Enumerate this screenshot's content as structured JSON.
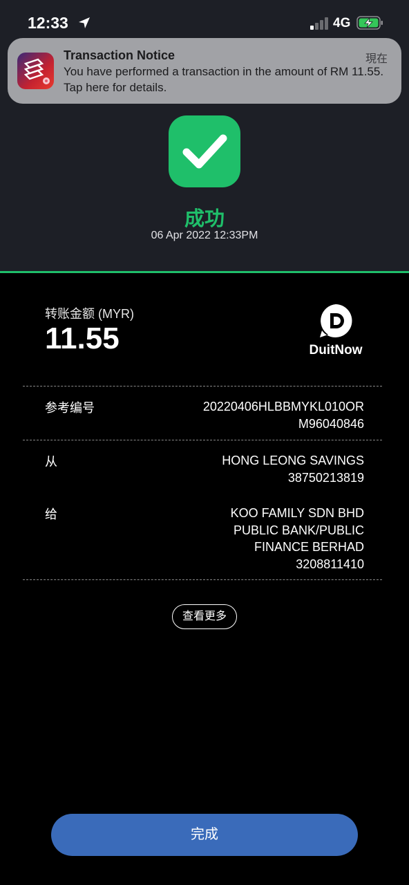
{
  "status_bar": {
    "time": "12:33",
    "network": "4G",
    "icons": [
      "location-arrow-icon",
      "signal-icon",
      "battery-charging-icon"
    ]
  },
  "notification": {
    "title": "Transaction Notice",
    "time": "現在",
    "body": "You have performed a transaction in the amount of RM 11.55. Tap here for details.",
    "app_icon": "bank-app-icon"
  },
  "result": {
    "icon": "checkmark-icon",
    "status": "成功",
    "datetime": "06 Apr 2022 12:33PM"
  },
  "transfer": {
    "amount_label": "转账金额 (MYR)",
    "amount": "11.55",
    "brand": "DuitNow"
  },
  "details": {
    "reference": {
      "label": "参考编号",
      "line1": "20220406HLBBMYKL010OR",
      "line2": "M96040846"
    },
    "from": {
      "label": "从",
      "line1": "HONG LEONG SAVINGS",
      "line2": "38750213819"
    },
    "to": {
      "label": "给",
      "line1": "KOO FAMILY SDN BHD",
      "line2": "PUBLIC BANK/PUBLIC",
      "line3": "FINANCE BERHAD",
      "line4": "3208811410"
    }
  },
  "actions": {
    "more_label": "查看更多",
    "done_label": "完成"
  },
  "colors": {
    "success": "#1fbf6a",
    "primary_button": "#3a6bba",
    "header_bg": "#1d1f26",
    "body_bg": "#000000"
  }
}
